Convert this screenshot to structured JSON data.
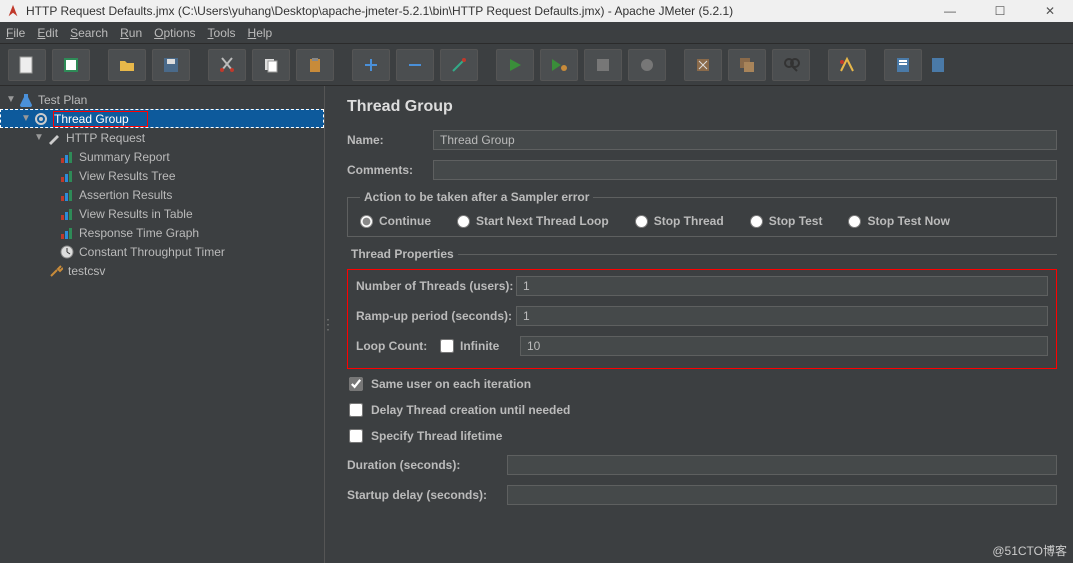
{
  "window": {
    "title": "HTTP Request Defaults.jmx (C:\\Users\\yuhang\\Desktop\\apache-jmeter-5.2.1\\bin\\HTTP Request Defaults.jmx) - Apache JMeter (5.2.1)"
  },
  "menu": {
    "file": "File",
    "edit": "Edit",
    "search": "Search",
    "run": "Run",
    "options": "Options",
    "tools": "Tools",
    "help": "Help"
  },
  "tree": {
    "testPlan": "Test Plan",
    "threadGroup": "Thread Group",
    "httpRequest": "HTTP Request",
    "summaryReport": "Summary Report",
    "viewResultsTree": "View Results Tree",
    "assertionResults": "Assertion Results",
    "viewResultsInTable": "View Results in Table",
    "responseTimeGraph": "Response Time Graph",
    "constantThroughputTimer": "Constant Throughput Timer",
    "testcsv": "testcsv"
  },
  "panel": {
    "heading": "Thread Group",
    "nameLabel": "Name:",
    "nameValue": "Thread Group",
    "commentsLabel": "Comments:",
    "commentsValue": "",
    "errorActionLegend": "Action to be taken after a Sampler error",
    "radios": {
      "continue": "Continue",
      "startNext": "Start Next Thread Loop",
      "stopThread": "Stop Thread",
      "stopTest": "Stop Test",
      "stopTestNow": "Stop Test Now"
    },
    "threadPropsLegend": "Thread Properties",
    "numThreadsLabel": "Number of Threads (users):",
    "numThreadsValue": "1",
    "rampUpLabel": "Ramp-up period (seconds):",
    "rampUpValue": "1",
    "loopCountLabel": "Loop Count:",
    "infiniteLabel": "Infinite",
    "loopCountValue": "10",
    "sameUser": "Same user on each iteration",
    "delayThread": "Delay Thread creation until needed",
    "specifyLifetime": "Specify Thread lifetime",
    "durationLabel": "Duration (seconds):",
    "durationValue": "",
    "startupDelayLabel": "Startup delay (seconds):",
    "startupDelayValue": ""
  },
  "watermark": "@51CTO博客"
}
